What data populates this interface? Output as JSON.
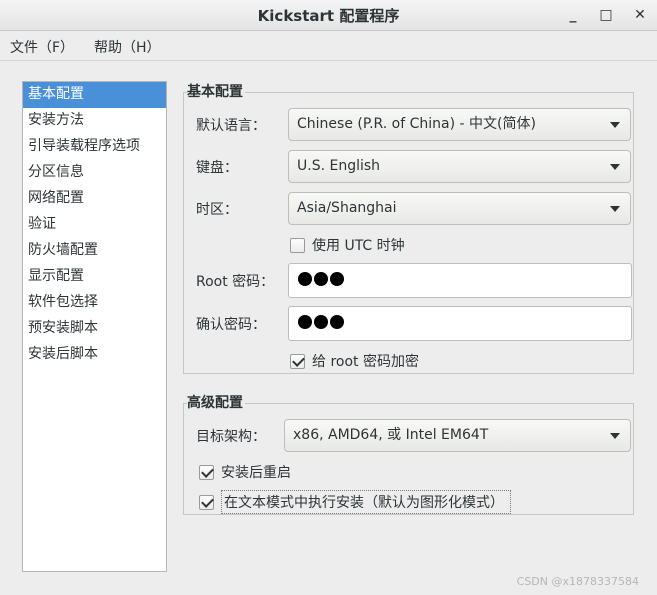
{
  "window": {
    "title": "Kickstart 配置程序",
    "minimize_label": "_",
    "maximize_label": "□",
    "close_label": "✕"
  },
  "menu": [
    {
      "label": "文件（F）"
    },
    {
      "label": "帮助（H）"
    }
  ],
  "sidebar": {
    "selected": "基本配置",
    "items": [
      {
        "label": "基本配置"
      },
      {
        "label": "安装方法"
      },
      {
        "label": "引导装载程序选项"
      },
      {
        "label": "分区信息"
      },
      {
        "label": "网络配置"
      },
      {
        "label": "验证"
      },
      {
        "label": "防火墙配置"
      },
      {
        "label": "显示配置"
      },
      {
        "label": "软件包选择"
      },
      {
        "label": "预安装脚本"
      },
      {
        "label": "安装后脚本"
      }
    ]
  },
  "basic": {
    "title": "基本配置",
    "language_label": "默认语言：",
    "language_value": "Chinese (P.R. of China) - 中文(简体)",
    "keyboard_label": "键盘：",
    "keyboard_value": "U.S. English",
    "timezone_label": "时区：",
    "timezone_value": "Asia/Shanghai",
    "utc_label": "使用  UTC 时钟",
    "utc_checked": false,
    "root_pw_label": "Root 密码：",
    "root_pw_dots": 3,
    "confirm_pw_label": "确认密码：",
    "confirm_pw_dots": 3,
    "encrypt_label": "给  root 密码加密",
    "encrypt_checked": true
  },
  "advanced": {
    "title": "高级配置",
    "arch_label": "目标架构：",
    "arch_value": "x86, AMD64, 或  Intel EM64T",
    "reboot_label": "安装后重启",
    "reboot_checked": true,
    "text_mode_label": "在文本模式中执行安装（默认为图形化模式）",
    "text_mode_checked": true
  },
  "watermark": "CSDN @x1878337584"
}
